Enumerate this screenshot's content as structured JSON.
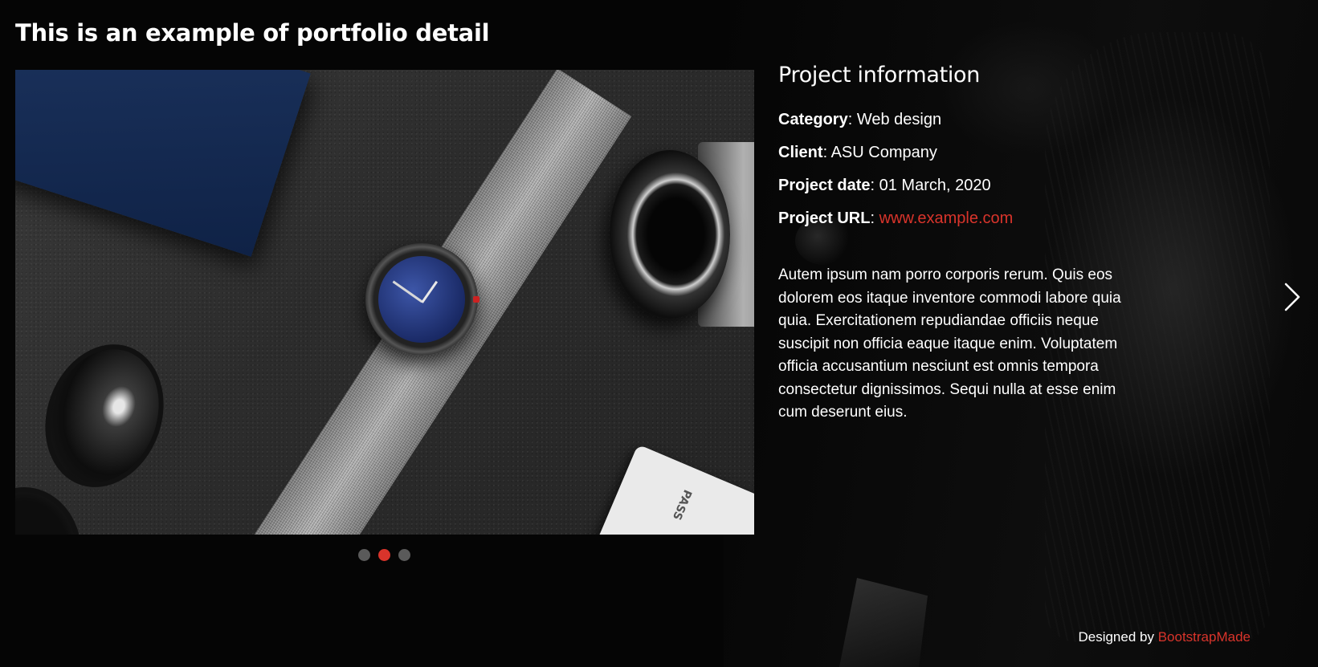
{
  "page": {
    "title": "This is an example of portfolio detail"
  },
  "carousel": {
    "slide_count": 3,
    "active_index": 1,
    "ticket_text": "PASS"
  },
  "project_info": {
    "heading": "Project information",
    "category_label": "Category",
    "category_value": "Web design",
    "client_label": "Client",
    "client_value": "ASU Company",
    "date_label": "Project date",
    "date_value": "01 March, 2020",
    "url_label": "Project URL",
    "url_value": "www.example.com",
    "separator": ": ",
    "description": "Autem ipsum nam porro corporis rerum. Quis eos dolorem eos itaque inventore commodi labore quia quia. Exercitationem repudiandae officiis neque suscipit non officia eaque itaque enim. Voluptatem officia accusantium nesciunt est omnis tempora consectetur dignissimos. Sequi nulla at esse enim cum deserunt eius."
  },
  "navigation": {
    "next_icon": "chevron-right-icon"
  },
  "footer": {
    "designed_by_text": "Designed by ",
    "designer_link": "BootstrapMade"
  },
  "colors": {
    "accent": "#d9342b",
    "background": "#050505",
    "text": "#ffffff",
    "dot_inactive": "#5a5a5a"
  }
}
